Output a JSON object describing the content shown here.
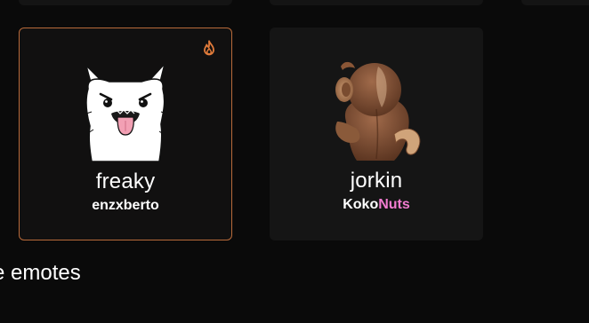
{
  "cards": [
    {
      "name": "freaky",
      "author": "enzxberto",
      "trending": true,
      "image_icon": "white-cat-tongue-emote"
    },
    {
      "name": "jorkin",
      "author_part1": "Koko",
      "author_part2": "Nuts",
      "image_icon": "brown-monkey-back-emote"
    }
  ],
  "section": {
    "title": "e emotes"
  },
  "colors": {
    "background": "#0a0a0a",
    "card": "#141414",
    "highlight_border": "#b86a3a",
    "fire": "#e07a3a",
    "author_accent": "#f27cd0"
  }
}
